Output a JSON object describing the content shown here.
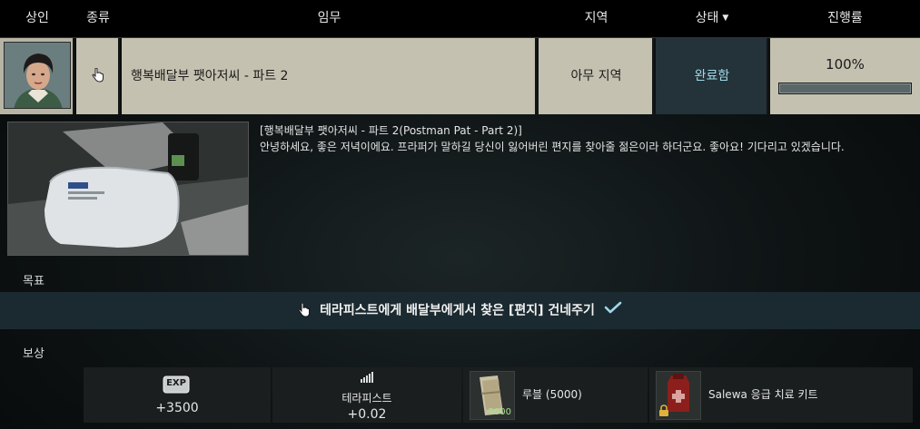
{
  "header": {
    "trader": "상인",
    "type": "종류",
    "task": "임무",
    "location": "지역",
    "status": "상태",
    "progress": "진행률"
  },
  "quest": {
    "name": "행복배달부 팻아저씨 - 파트 2",
    "location": "아무 지역",
    "status": "완료함",
    "progress_text": "100%",
    "progress_fraction": 1.0
  },
  "description": {
    "title": "[행복배달부 팻아저씨 - 파트 2(Postman Pat - Part 2)]",
    "body": "안녕하세요, 좋은 저녁이에요. 프라퍼가 말하길 당신이 잃어버린 편지를 찾아줄 젊은이라 하더군요. 좋아요! 기다리고 있겠습니다."
  },
  "objectives": {
    "heading": "목표",
    "items": [
      "테라피스트에게 배달부에게서 찾은 [편지] 건네주기"
    ]
  },
  "rewards": {
    "heading": "보상",
    "exp_badge": "EXP",
    "exp_value": "+3500",
    "reputation_trader": "테라피스트",
    "reputation_value": "+0.02",
    "rubles_label": "루블 (5000)",
    "rubles_stack": "5000",
    "medkit_label": "Salewa 응급 치료 키트"
  },
  "icons": {
    "type": "hand-pointer-icon",
    "objective_hand": "hand-pointer-icon",
    "objective_check": "check-icon",
    "reputation": "reputation-bars-icon",
    "lock": "lock-icon"
  }
}
